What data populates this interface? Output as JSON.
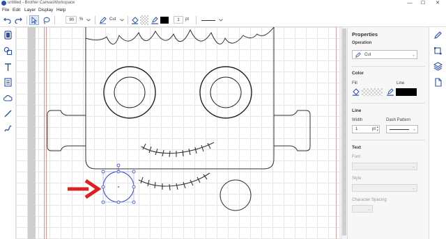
{
  "window": {
    "title": "untitled - Brother CanvasWorkspace",
    "minimize": "—",
    "maximize": "☐",
    "close": "✕"
  },
  "menu": [
    "File",
    "Edit",
    "Layer",
    "Display",
    "Help"
  ],
  "toolbar": {
    "zoom_value": "90",
    "zoom_unit": "%",
    "operation": "Cut",
    "line_width": "1",
    "line_unit": "pt"
  },
  "properties": {
    "title": "Properties",
    "operation_label": "Operation",
    "operation_value": "Cut",
    "color_label": "Color",
    "fill_label": "Fill",
    "line_label": "Line",
    "line_color": "#000000",
    "line_section": "Line",
    "width_label": "Width",
    "width_value": "1",
    "width_unit": "pt",
    "dash_label": "Dash Pattern",
    "text_section": "Text",
    "font_label": "Font",
    "style_label": "Style",
    "spacing_label": "Character Spacing"
  },
  "icons": {
    "undo": "undo-icon",
    "redo": "redo-icon",
    "select": "pointer-icon",
    "lasso": "lasso-icon",
    "pen": "pen-icon",
    "fill": "fill-bucket-icon",
    "line_pen": "line-pen-icon",
    "left": [
      "fill-icon",
      "shapes-icon",
      "text-icon",
      "pattern-icon",
      "cloud-icon",
      "line-icon",
      "freehand-icon"
    ],
    "right": [
      "properties-icon",
      "transform-icon",
      "layers-icon",
      "page-icon"
    ]
  },
  "colors": {
    "selection": "#2b3bd9",
    "arrow": "#e02020",
    "accent": "#2a4fb0"
  }
}
